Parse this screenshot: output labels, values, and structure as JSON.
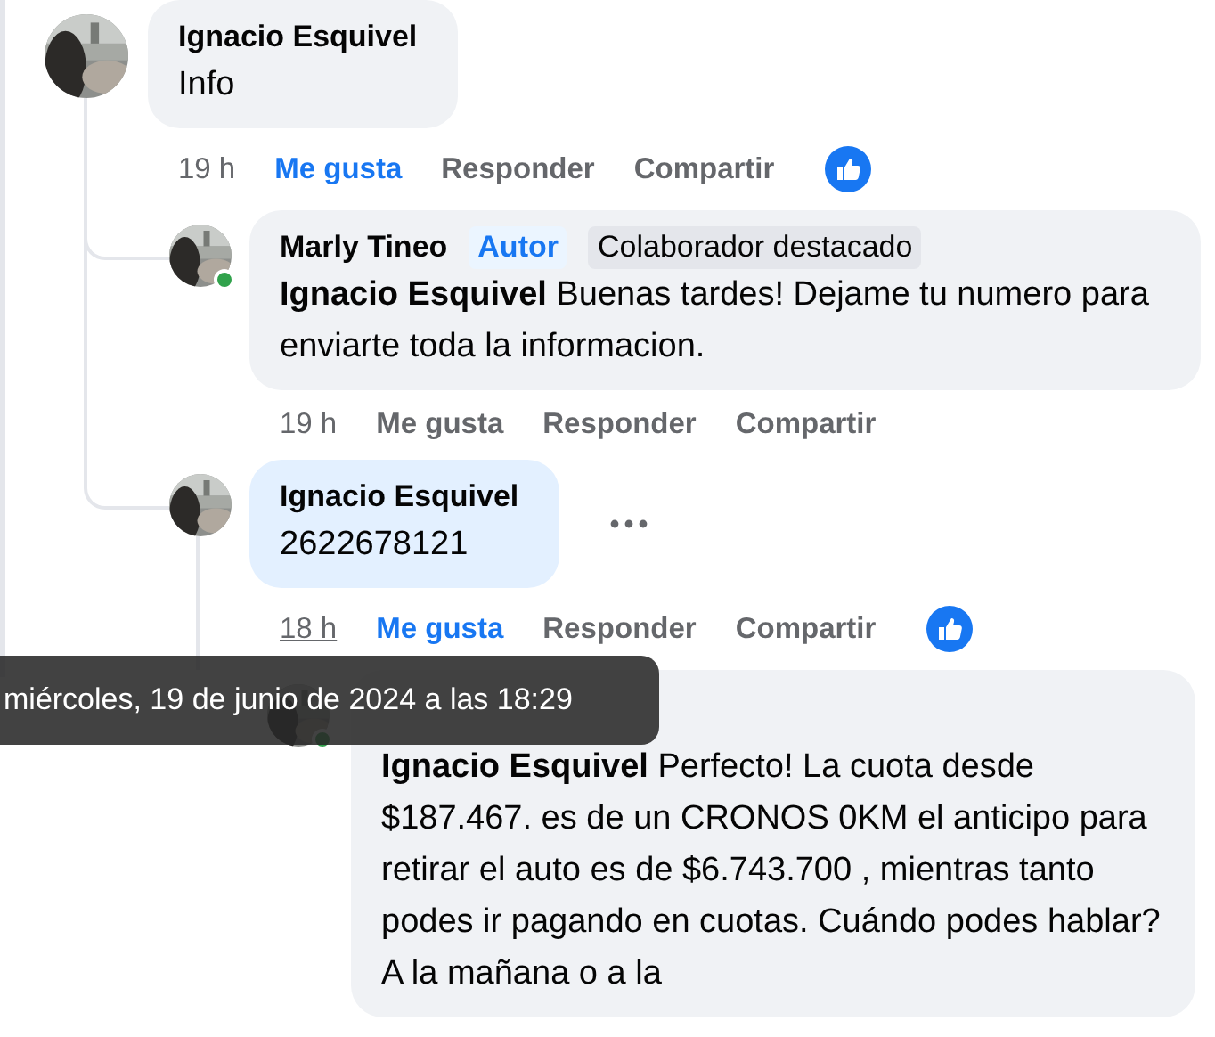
{
  "comments": [
    {
      "author": "Ignacio Esquivel",
      "text": "Info",
      "time": "19 h",
      "like_label": "Me gusta",
      "liked": true,
      "reply_label": "Responder",
      "share_label": "Compartir",
      "like_reaction": true,
      "children": [
        {
          "author": "Marly Tineo",
          "badges": [
            {
              "label": "Autor",
              "kind": "author"
            },
            {
              "label": "Colaborador destacado",
              "kind": "top_contributor"
            }
          ],
          "mention": "Ignacio Esquivel",
          "text": "Buenas tardes! Dejame tu numero para enviarte toda la informacion.",
          "online": true,
          "time": "19 h",
          "like_label": "Me gusta",
          "liked": false,
          "reply_label": "Responder",
          "share_label": "Compartir"
        },
        {
          "author": "Ignacio Esquivel",
          "text": "2622678121",
          "highlighted": true,
          "time": "18 h",
          "time_hovered": true,
          "like_label": "Me gusta",
          "liked": true,
          "reply_label": "Responder",
          "share_label": "Compartir",
          "like_reaction": true,
          "menu_visible": true,
          "children": [
            {
              "mention": "Ignacio Esquivel",
              "text": "Perfecto! La cuota desde $187.467. es de un CRONOS 0KM el anticipo para retirar el auto es de $6.743.700 , mientras tanto podes ir pagando en cuotas. Cuándo podes hablar? A la mañana o a la",
              "online": true
            }
          ]
        }
      ]
    }
  ],
  "tooltip": {
    "text": "miércoles, 19 de junio de 2024 a las 18:29"
  }
}
